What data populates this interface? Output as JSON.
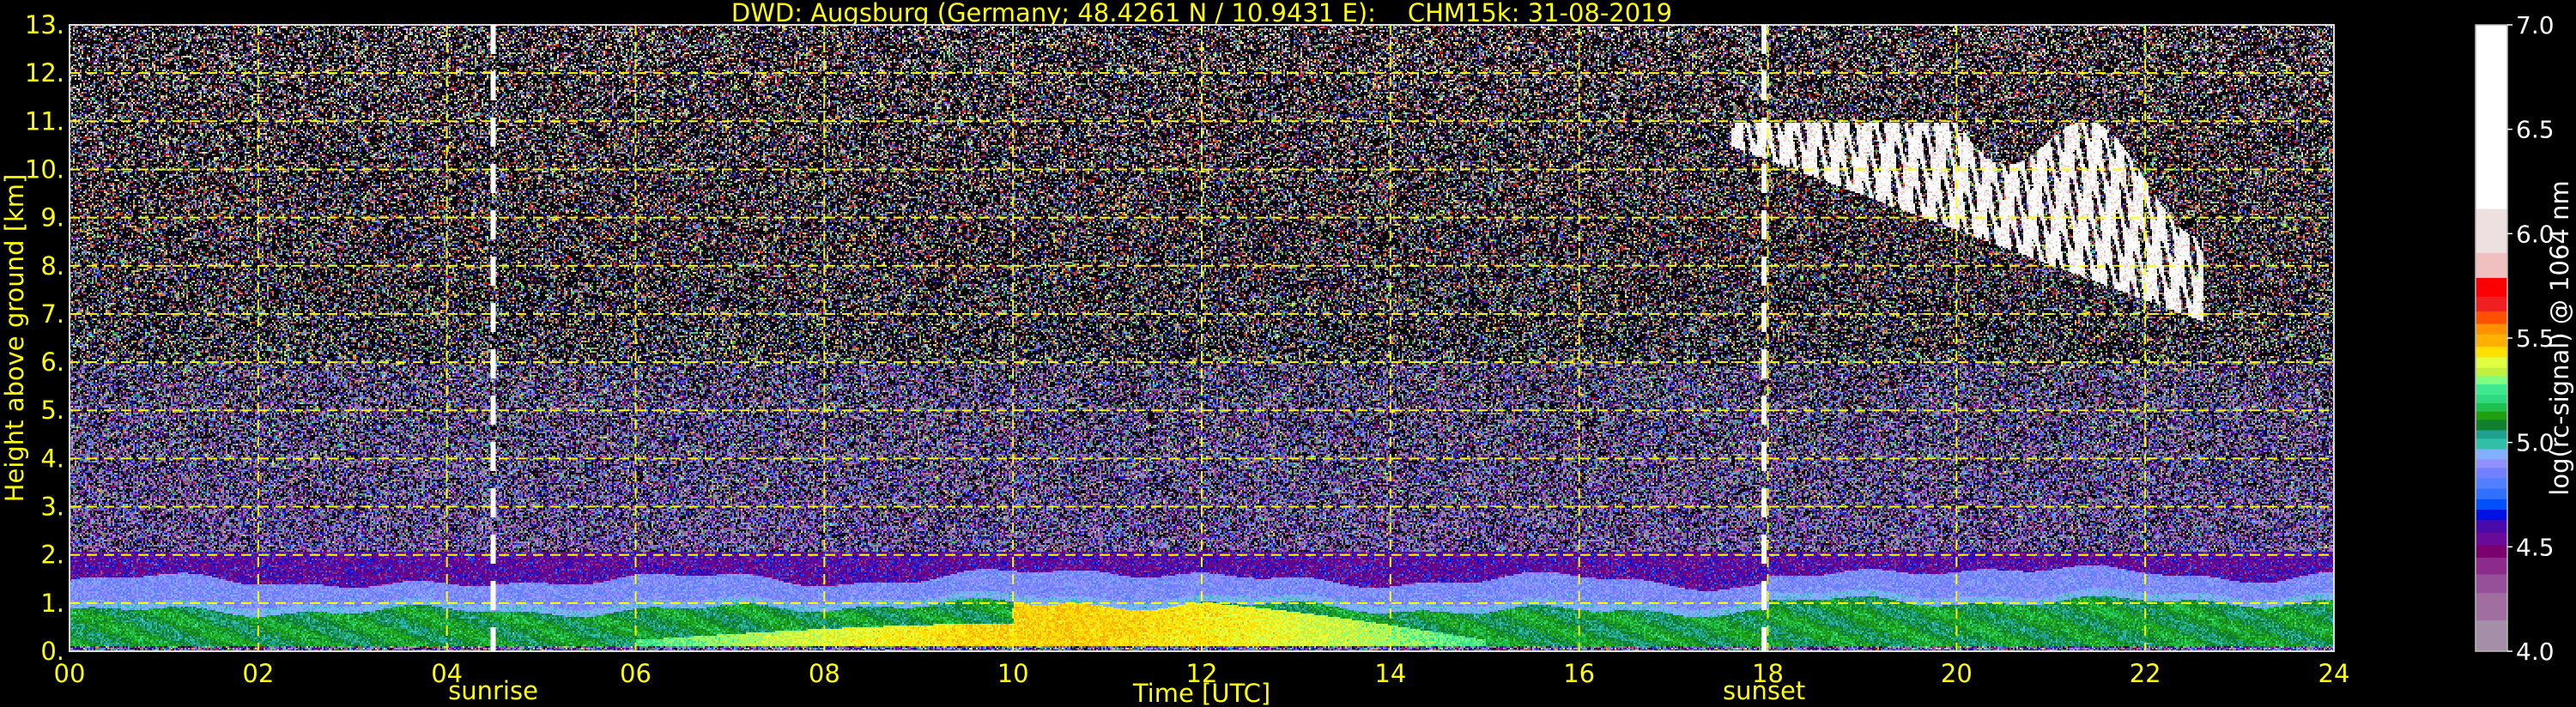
{
  "title": "DWD: Augsburg (Germany; 48.4261 N / 10.9431 E):    CHM15k: 31-08-2019",
  "chart_data": {
    "type": "heatmap",
    "title": "DWD: Augsburg (Germany; 48.4261 N / 10.9431 E):    CHM15k: 31-08-2019",
    "xlabel": "Time [UTC]",
    "ylabel": "Height above ground [km]",
    "xlim": [
      0,
      24
    ],
    "ylim": [
      0,
      13
    ],
    "xticks": [
      0,
      2,
      4,
      6,
      8,
      10,
      12,
      14,
      16,
      18,
      20,
      22,
      24
    ],
    "xtick_labels": [
      "00",
      "02",
      "04",
      "06",
      "08",
      "10",
      "12",
      "14",
      "16",
      "18",
      "20",
      "22",
      "24"
    ],
    "yticks": [
      0,
      1,
      2,
      3,
      4,
      5,
      6,
      7,
      8,
      9,
      10,
      11,
      12,
      13
    ],
    "ytick_labels": [
      "0.",
      "1.",
      "2.",
      "3.",
      "4.",
      "5.",
      "6.",
      "7.",
      "8.",
      "9.",
      "10.",
      "11.",
      "12.",
      "13."
    ],
    "grid": true,
    "annotations": [
      {
        "label": "sunrise",
        "x": 4.49
      },
      {
        "label": "sunset",
        "x": 17.96
      }
    ],
    "features": [
      {
        "name": "residual layer",
        "t": [
          0,
          24
        ],
        "h": [
          1.0,
          2.0
        ],
        "value": 4.6
      },
      {
        "name": "boundary layer aerosol",
        "t": [
          0,
          24
        ],
        "h": [
          0.1,
          1.2
        ],
        "value": 5.1
      },
      {
        "name": "enhanced aerosol",
        "t": [
          6,
          15
        ],
        "h": [
          0.1,
          1.3
        ],
        "value": 5.4
      },
      {
        "name": "cirrus cloud",
        "t": [
          17.6,
          22.6
        ],
        "h": [
          7.2,
          11.0
        ],
        "value": 6.5
      }
    ],
    "colorbar": {
      "label": "log(rc-signal) @ 1064 nm",
      "clim": [
        4.0,
        7.0
      ],
      "ticks": [
        "4.0",
        "4.5",
        "5.0",
        "5.5",
        "6.0",
        "6.5",
        "7.0"
      ],
      "bounds": [
        4.0,
        4.15,
        4.28,
        4.37,
        4.45,
        4.51,
        4.57,
        4.63,
        4.68,
        4.73,
        4.78,
        4.83,
        4.88,
        4.92,
        4.97,
        5.02,
        5.06,
        5.11,
        5.15,
        5.19,
        5.23,
        5.28,
        5.32,
        5.36,
        5.41,
        5.46,
        5.52,
        5.57,
        5.63,
        5.7,
        5.79,
        5.91,
        6.12,
        7.0
      ],
      "colors": [
        "#a58fa8",
        "#a06fa0",
        "#96509a",
        "#8b2b8b",
        "#7a0070",
        "#6a0a9a",
        "#4a0aaa",
        "#0010e0",
        "#0050ff",
        "#3070ff",
        "#5080ff",
        "#7080ff",
        "#9090ff",
        "#80b0ff",
        "#30c0a8",
        "#20a090",
        "#108030",
        "#20a010",
        "#20c050",
        "#30d880",
        "#40e890",
        "#80ff80",
        "#c0f040",
        "#e0ff40",
        "#ffe000",
        "#ffb000",
        "#ff9000",
        "#ff5000",
        "#f02020",
        "#ff0000",
        "#f0c0c0",
        "#ece0e0",
        "#ffffff"
      ]
    }
  },
  "colors": {
    "axis_text": "#ffff00",
    "grid": "#ffff00",
    "colorbar_text": "#ffffff",
    "marker_line": "#ffffff"
  }
}
